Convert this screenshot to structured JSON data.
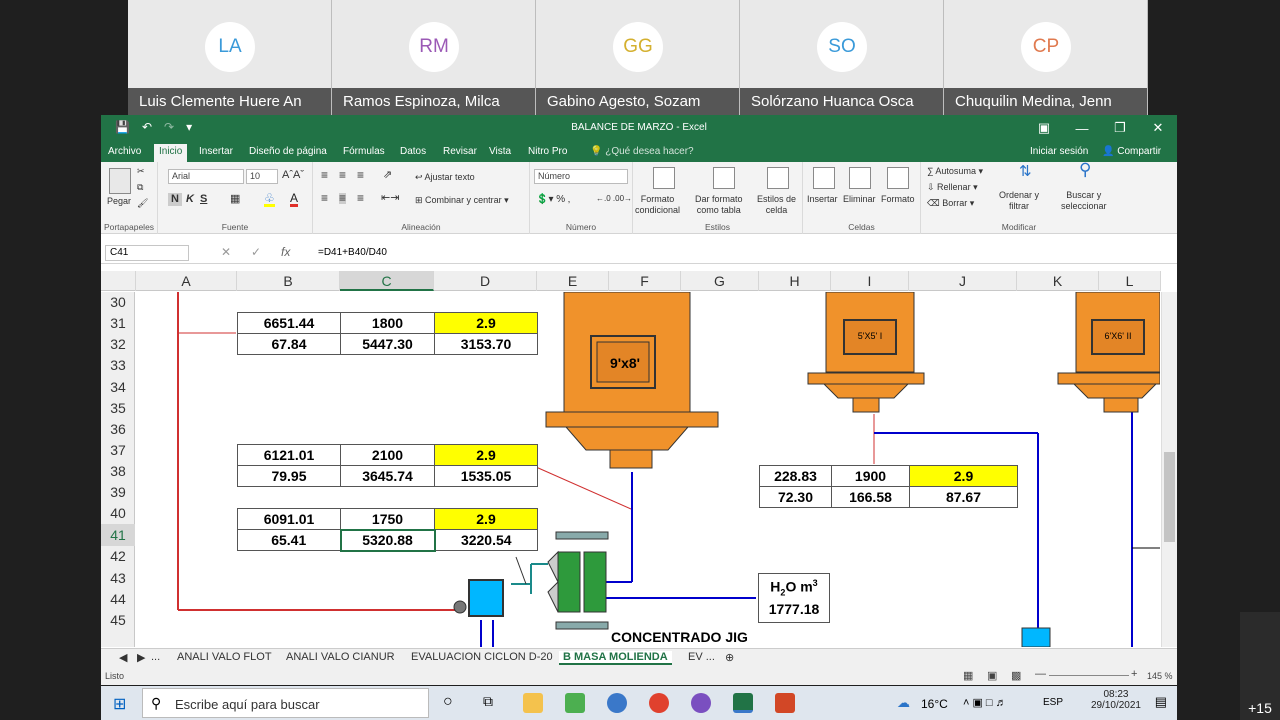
{
  "participants": [
    {
      "initials": "LA",
      "name": "Luis Clemente Huere An",
      "color": "#3a9ad9"
    },
    {
      "initials": "RM",
      "name": "Ramos Espinoza, Milca",
      "color": "#9b59b6"
    },
    {
      "initials": "GG",
      "name": "Gabino Agesto, Sozam",
      "color": "#d4b02f"
    },
    {
      "initials": "SO",
      "name": "Solórzano Huanca Osca",
      "color": "#3a9ad9"
    },
    {
      "initials": "CP",
      "name": "Chuquilin Medina, Jenn",
      "color": "#e07a4f"
    }
  ],
  "more_participants": "+15",
  "window": {
    "title": "BALANCE DE MARZO  -  Excel"
  },
  "ribbon_tabs": [
    "Archivo",
    "Inicio",
    "Insertar",
    "Diseño de página",
    "Fórmulas",
    "Datos",
    "Revisar",
    "Vista",
    "Nitro Pro"
  ],
  "tell_me": "¿Qué desea hacer?",
  "signin": "Iniciar sesión",
  "share": "Compartir",
  "ribbon": {
    "paste": "Pegar",
    "font_name": "Arial",
    "font_size": "10",
    "number_format": "Número",
    "wrap": "Ajustar texto",
    "merge": "Combinar y centrar",
    "cond_format": "Formato\ncondicional",
    "table_format": "Dar formato\ncomo tabla",
    "cell_styles": "Estilos de\ncelda",
    "insert": "Insertar",
    "delete": "Eliminar",
    "format": "Formato",
    "autosum": "Autosuma",
    "fill": "Rellenar",
    "clear": "Borrar",
    "sort": "Ordenar y\nfiltrar",
    "find": "Buscar y\nseleccionar",
    "groups": [
      "Portapapeles",
      "Fuente",
      "Alineación",
      "Número",
      "Estilos",
      "Celdas",
      "Modificar"
    ]
  },
  "formula_bar": {
    "cell": "C41",
    "formula": "=D41+B40/D40"
  },
  "columns": [
    "A",
    "B",
    "C",
    "D",
    "E",
    "F",
    "G",
    "H",
    "I",
    "J",
    "K",
    "L"
  ],
  "rows": [
    "30",
    "31",
    "32",
    "33",
    "34",
    "35",
    "36",
    "37",
    "38",
    "39",
    "40",
    "41",
    "42",
    "43",
    "44",
    "45"
  ],
  "tables": {
    "t1": [
      [
        "6651.44",
        "1800",
        "2.9"
      ],
      [
        "67.84",
        "5447.30",
        "3153.70"
      ]
    ],
    "t2": [
      [
        "6121.01",
        "2100",
        "2.9"
      ],
      [
        "79.95",
        "3645.74",
        "1535.05"
      ]
    ],
    "t3": [
      [
        "6091.01",
        "1750",
        "2.9"
      ],
      [
        "65.41",
        "5320.88",
        "3220.54"
      ]
    ],
    "t4": [
      [
        "228.83",
        "1900",
        "2.9"
      ],
      [
        "72.30",
        "166.58",
        "87.67"
      ]
    ]
  },
  "mills": {
    "m1": "9'x8'",
    "m2": "5'X5' I",
    "m3": "6'X6' II"
  },
  "water": {
    "label": "H",
    "sub": "2",
    "mid": "O m",
    "sup": "3",
    "value": "1777.18"
  },
  "concentrado": "CONCENTRADO JIG",
  "sheet_tabs": [
    "...",
    "ANALI VALO FLOT",
    "ANALI VALO CIANUR",
    "EVALUACION CICLON D-20",
    "B MASA MOLIENDA",
    "EV ..."
  ],
  "status": {
    "ready": "Listo",
    "zoom": "145 %"
  },
  "taskbar": {
    "search": "Escribe aquí para buscar",
    "temp": "16°C",
    "lang": "ESP",
    "time": "08:23",
    "date": "29/10/2021"
  }
}
